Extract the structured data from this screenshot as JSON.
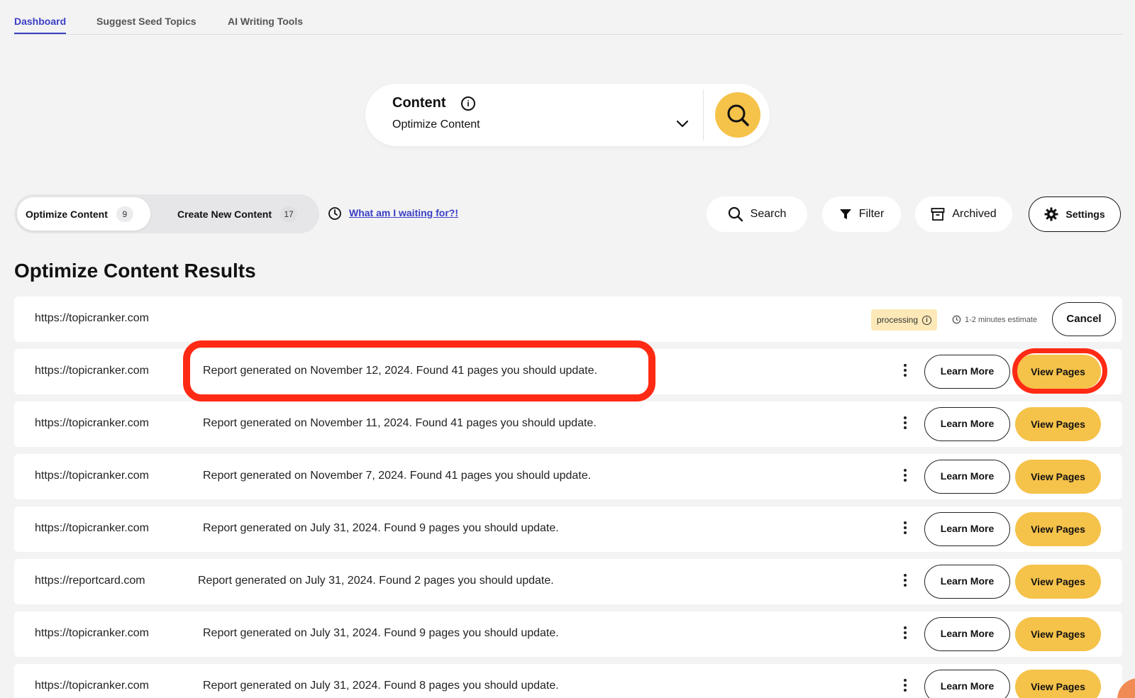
{
  "nav": {
    "tabs": [
      {
        "label": "Dashboard",
        "active": true
      },
      {
        "label": "Suggest Seed Topics",
        "active": false
      },
      {
        "label": "AI Writing Tools",
        "active": false
      }
    ]
  },
  "selector": {
    "title": "Content",
    "value": "Optimize Content"
  },
  "toggle": {
    "options": [
      {
        "label": "Optimize Content",
        "count": "9",
        "active": true
      },
      {
        "label": "Create New Content",
        "count": "17",
        "active": false
      }
    ],
    "wait_link": "What am I waiting for?!"
  },
  "toolbar": {
    "search_label": "Search",
    "filter_label": "Filter",
    "archived_label": "Archived",
    "settings_label": "Settings"
  },
  "results": {
    "title": "Optimize Content Results",
    "processing_row": {
      "url": "https://topicranker.com",
      "status": "processing",
      "estimate": "1-2 minutes estimate",
      "cancel_label": "Cancel"
    },
    "learn_label": "Learn More",
    "view_label": "View Pages",
    "rows": [
      {
        "url": "https://topicranker.com",
        "message": "Report generated on November 12, 2024. Found 41 pages you should update."
      },
      {
        "url": "https://topicranker.com",
        "message": "Report generated on November 11, 2024. Found 41 pages you should update."
      },
      {
        "url": "https://topicranker.com",
        "message": "Report generated on November 7, 2024. Found 41 pages you should update."
      },
      {
        "url": "https://topicranker.com",
        "message": "Report generated on July 31, 2024. Found 9 pages you should update."
      },
      {
        "url": "https://reportcard.com",
        "message": "Report generated on July 31, 2024. Found 2 pages you should update."
      },
      {
        "url": "https://topicranker.com",
        "message": "Report generated on July 31, 2024. Found 9 pages you should update."
      },
      {
        "url": "https://topicranker.com",
        "message": "Report generated on July 31, 2024. Found 8 pages you should update."
      }
    ]
  },
  "colors": {
    "accent": "#3b3fc4",
    "primary_button": "#f5c24a",
    "highlight": "#ff2a14",
    "processing_badge": "#fde9b8"
  }
}
